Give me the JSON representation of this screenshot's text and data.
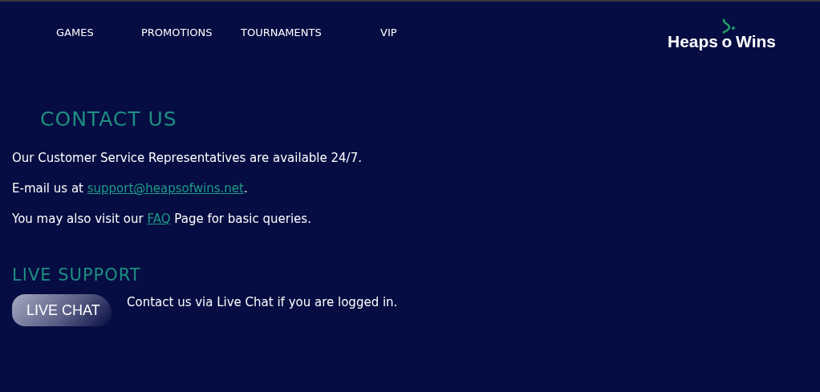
{
  "nav": [
    {
      "label": "GAMES"
    },
    {
      "label": "PROMOTIONS"
    },
    {
      "label": "TOURNAMENTS"
    },
    {
      "label": "VIP"
    }
  ],
  "logo": {
    "left": "Heaps",
    "middle": "o",
    "right": "Wins"
  },
  "contact": {
    "title": "CONTACT US",
    "lines": [
      {
        "before": "Our Customer Service Representatives are available 24/7."
      },
      {
        "before": "E-mail us at ",
        "link": "support@heapsofwins.net",
        "after": "."
      },
      {
        "before": "You may also visit our ",
        "link": "FAQ",
        "after": " Page for basic queries."
      }
    ]
  },
  "live": {
    "title": "LIVE SUPPORT",
    "button": "LIVE CHAT",
    "text": "Contact us via Live Chat if you are logged in."
  }
}
